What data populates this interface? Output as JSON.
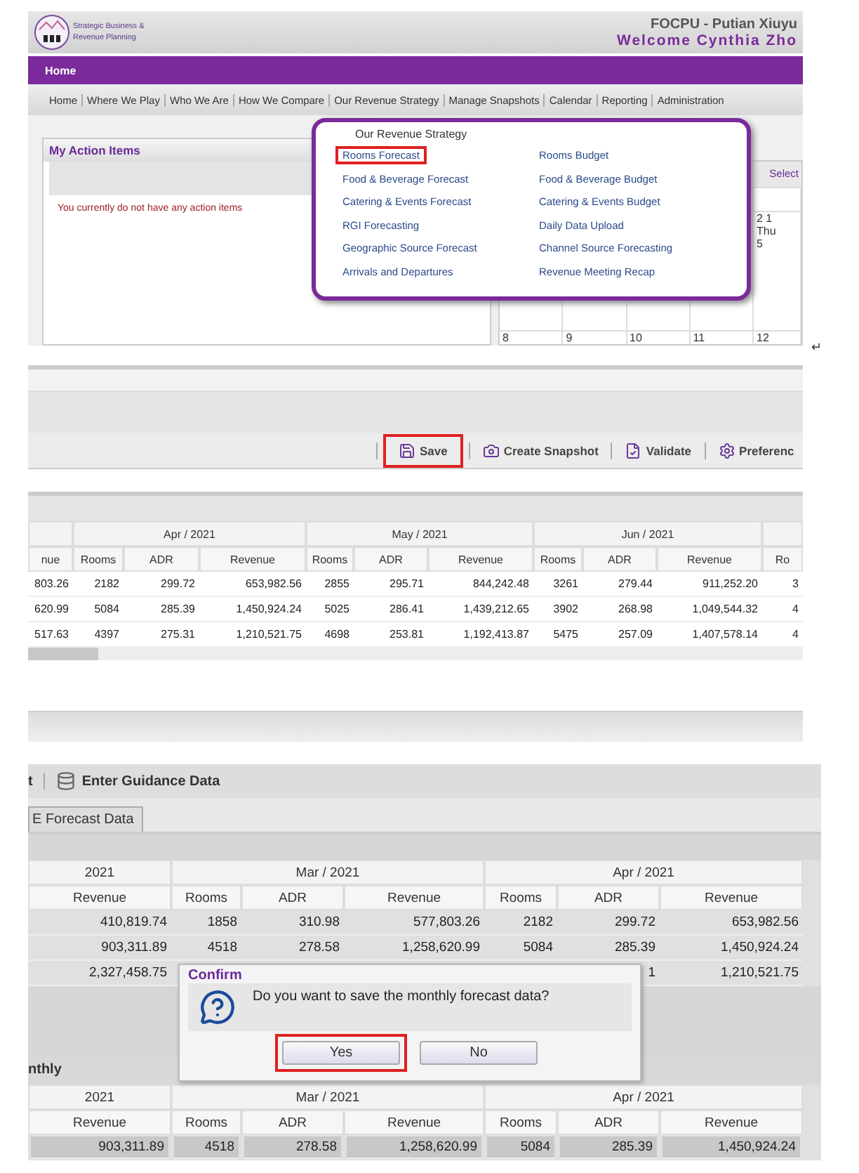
{
  "app": {
    "logo_lines": [
      "Strategic Business &",
      "Revenue Planning"
    ],
    "property": "FOCPU - Putian Xiuyu",
    "welcome": "Welcome Cynthia Zho",
    "primary_tabs": [
      {
        "label": "Home",
        "selected": true
      }
    ],
    "nav": [
      "Home",
      "Where We Play",
      "Who We Are",
      "How We Compare",
      "Our Revenue Strategy",
      "Manage Snapshots",
      "Calendar",
      "Reporting",
      "Administration"
    ],
    "action_items": {
      "title": "My Action Items",
      "message": "You currently do not have any action items"
    },
    "calendar": {
      "select": "Select",
      "week_label": "2 1",
      "day": "Thu",
      "date": "5",
      "dates": [
        "8",
        "9",
        "10",
        "11",
        "12"
      ]
    },
    "menu": {
      "title": "Our Revenue Strategy",
      "items": [
        {
          "label": "Rooms Forecast",
          "highlighted": true
        },
        {
          "label": "Rooms Budget",
          "highlighted": false
        },
        {
          "label": "Food & Beverage Forecast",
          "highlighted": false
        },
        {
          "label": "Food & Beverage Budget",
          "highlighted": false
        },
        {
          "label": "Catering & Events Forecast",
          "highlighted": false
        },
        {
          "label": "Catering & Events Budget",
          "highlighted": false
        },
        {
          "label": "RGI Forecasting",
          "highlighted": false
        },
        {
          "label": "Daily Data Upload",
          "highlighted": false
        },
        {
          "label": "Geographic Source Forecast",
          "highlighted": false
        },
        {
          "label": "Channel Source Forecasting",
          "highlighted": false
        },
        {
          "label": "Arrivals and Departures",
          "highlighted": false
        },
        {
          "label": "Revenue Meeting Recap",
          "highlighted": false
        }
      ]
    }
  },
  "paragraph_mark": "↵",
  "toolbar": [
    {
      "label": "Save",
      "kind": "save",
      "highlighted": true
    },
    {
      "label": "Create Snapshot",
      "kind": "snapshot",
      "highlighted": false
    },
    {
      "label": "Validate",
      "kind": "validate",
      "highlighted": false
    },
    {
      "label": "Preferenc",
      "kind": "preferences",
      "highlighted": false
    }
  ],
  "table_1": {
    "months": [
      "Apr / 2021",
      "May / 2021",
      "Jun / 2021"
    ],
    "columns": [
      "nue",
      "Rooms",
      "ADR",
      "Revenue",
      "Rooms",
      "ADR",
      "Revenue",
      "Rooms",
      "ADR",
      "Revenue",
      "Ro"
    ],
    "rows": [
      [
        "803.26",
        "2182",
        "299.72",
        "653,982.56",
        "2855",
        "295.71",
        "844,242.48",
        "3261",
        "279.44",
        "911,252.20",
        "3"
      ],
      [
        "620.99",
        "5084",
        "285.39",
        "1,450,924.24",
        "5025",
        "286.41",
        "1,439,212.65",
        "3902",
        "268.98",
        "1,049,544.32",
        "4"
      ],
      [
        "517.63",
        "4397",
        "275.31",
        "1,210,521.75",
        "4698",
        "253.81",
        "1,192,413.87",
        "5475",
        "257.09",
        "1,407,578.14",
        "4"
      ]
    ]
  },
  "screen_2": {
    "toolbar": [
      "t",
      "Enter Guidance Data"
    ],
    "tab": "E Forecast Data",
    "table": {
      "months": [
        "2021",
        "Mar / 2021",
        "Apr / 2021"
      ],
      "columns": [
        "Revenue",
        "Rooms",
        "ADR",
        "Revenue",
        "Rooms",
        "ADR",
        "Revenue"
      ],
      "rows": [
        [
          "410,819.74",
          "1858",
          "310.98",
          "577,803.26",
          "2182",
          "299.72",
          "653,982.56"
        ],
        [
          "903,311.89",
          "4518",
          "278.58",
          "1,258,620.99",
          "5084",
          "285.39",
          "1,450,924.24"
        ],
        [
          "2,327,458.75",
          null,
          null,
          null,
          null,
          "1",
          "1,210,521.75"
        ]
      ]
    },
    "section": "nthly",
    "table_2": {
      "months": [
        "2021",
        "Mar / 2021",
        "Apr / 2021"
      ],
      "columns": [
        "Revenue",
        "Rooms",
        "ADR",
        "Revenue",
        "Rooms",
        "ADR",
        "Revenue"
      ],
      "rows": [
        [
          "903,311.89",
          "4518",
          "278.58",
          "1,258,620.99",
          "5084",
          "285.39",
          "1,450,924.24"
        ]
      ]
    },
    "dialog": {
      "title": "Confirm",
      "message": "Do you want to save the monthly forecast data?",
      "buttons": [
        {
          "label": "Yes",
          "highlighted": true
        },
        {
          "label": "No",
          "highlighted": false
        }
      ]
    }
  }
}
